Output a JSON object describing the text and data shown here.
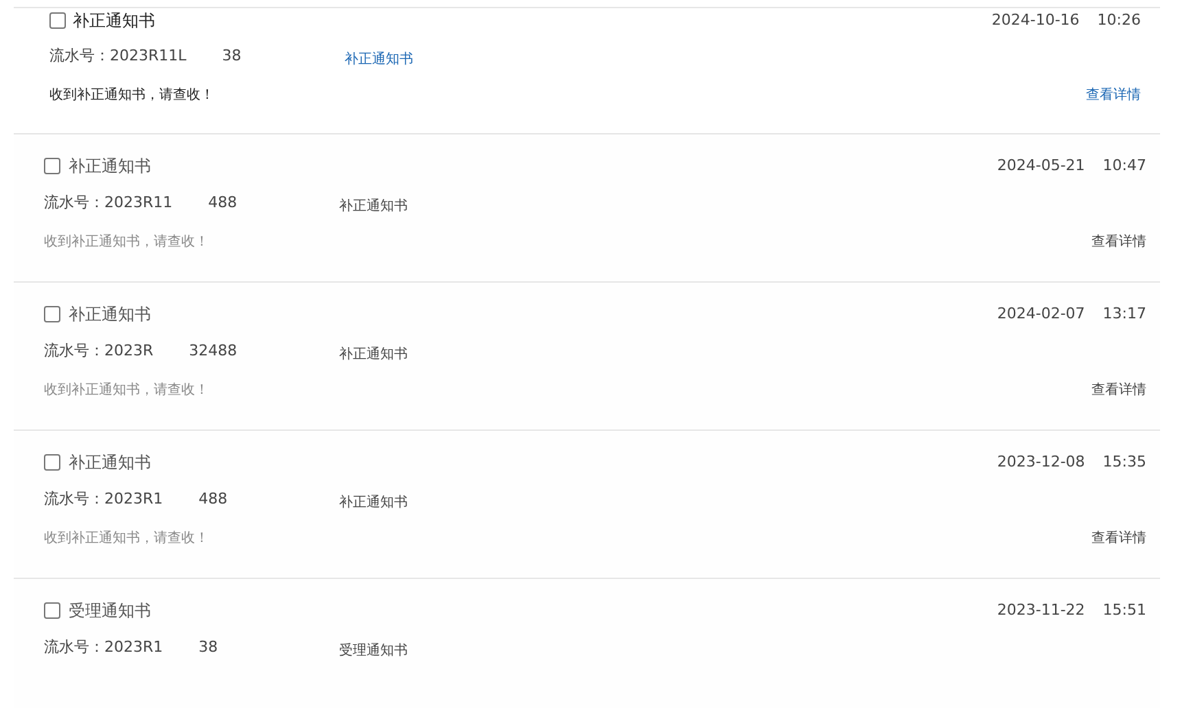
{
  "notices": [
    {
      "title": "补正通知书",
      "checked": false,
      "highlighted": true,
      "serial_label": "流水号：",
      "serial": "2023R11L",
      "serial_tail": "38",
      "type": "补正通知书",
      "message": "收到补正通知书，请查收！",
      "date": "2024-10-16",
      "time": "10:26",
      "link": "查看详情"
    },
    {
      "title": "补正通知书",
      "checked": false,
      "highlighted": false,
      "serial_label": "流水号：",
      "serial": "2023R11",
      "serial_tail": "488",
      "type": "补正通知书",
      "message": "收到补正通知书，请查收！",
      "date": "2024-05-21",
      "time": "10:47",
      "link": "查看详情"
    },
    {
      "title": "补正通知书",
      "checked": false,
      "highlighted": false,
      "serial_label": "流水号：",
      "serial": "2023R",
      "serial_tail": "32488",
      "type": "补正通知书",
      "message": "收到补正通知书，请查收！",
      "date": "2024-02-07",
      "time": "13:17",
      "link": "查看详情"
    },
    {
      "title": "补正通知书",
      "checked": false,
      "highlighted": false,
      "serial_label": "流水号：",
      "serial": "2023R1",
      "serial_tail": "488",
      "type": "补正通知书",
      "message": "收到补正通知书，请查收！",
      "date": "2023-12-08",
      "time": "15:35",
      "link": "查看详情"
    },
    {
      "title": "受理通知书",
      "checked": false,
      "highlighted": false,
      "serial_label": "流水号：",
      "serial": "2023R1",
      "serial_tail": "38",
      "type": "受理通知书",
      "date": "2023-11-22",
      "time": "15:51"
    }
  ]
}
